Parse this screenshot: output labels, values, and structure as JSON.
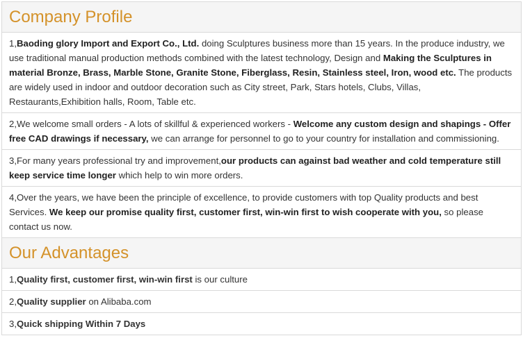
{
  "company_profile": {
    "title": "Company Profile",
    "items": [
      {
        "p1": "1,",
        "b1": "Baoding glory Import and Export Co., Ltd.",
        "p2": " doing Sculptures business more than 15 years. In the produce industry, we use traditional manual production methods combined with the latest technology, Design and ",
        "b2": "Making the Sculptures in material Bronze, Brass, Marble Stone, Granite Stone, Fiberglass, Resin, Stainless steel, Iron, wood etc.",
        "p3": " The products are widely used in indoor and outdoor decoration such as City street, Park, Stars hotels, Clubs, Villas, Restaurants,Exhibition halls, Room, Table etc."
      },
      {
        "p1": "2,We welcome small orders - A lots of skillful & experienced workers - ",
        "b1": "Welcome any custom design and shapings - Offer free CAD drawings if necessary,",
        "p2": " we can arrange for personnel to go to your country for installation and commissioning."
      },
      {
        "p1": "3,For many years professional try and improvement,",
        "b1": "our products can against bad weather and cold temperature still keep service time longer",
        "p2": " which help to win more orders."
      },
      {
        "p1": "4,Over the years, we have been the principle of excellence, to provide customers with top Quality products and best Services. ",
        "b1": "We keep our promise quality first, customer first, win-win first to wish cooperate with you,",
        "p2": " so please contact us now."
      }
    ]
  },
  "our_advantages": {
    "title": "Our Advantages",
    "items": [
      {
        "p1": "1,",
        "b1": "Quality first, customer first, win-win first",
        "p2": " is our culture"
      },
      {
        "p1": "2,",
        "b1": "Quality supplier",
        "p2": " on Alibaba.com"
      },
      {
        "p1": "3,",
        "b1": "Quick shipping Within 7 Days",
        "p2": ""
      }
    ]
  },
  "colors": {
    "heading": "#d4922a",
    "heading_bg": "#f5f5f5",
    "border": "#d9d9d9",
    "text": "#333333"
  }
}
